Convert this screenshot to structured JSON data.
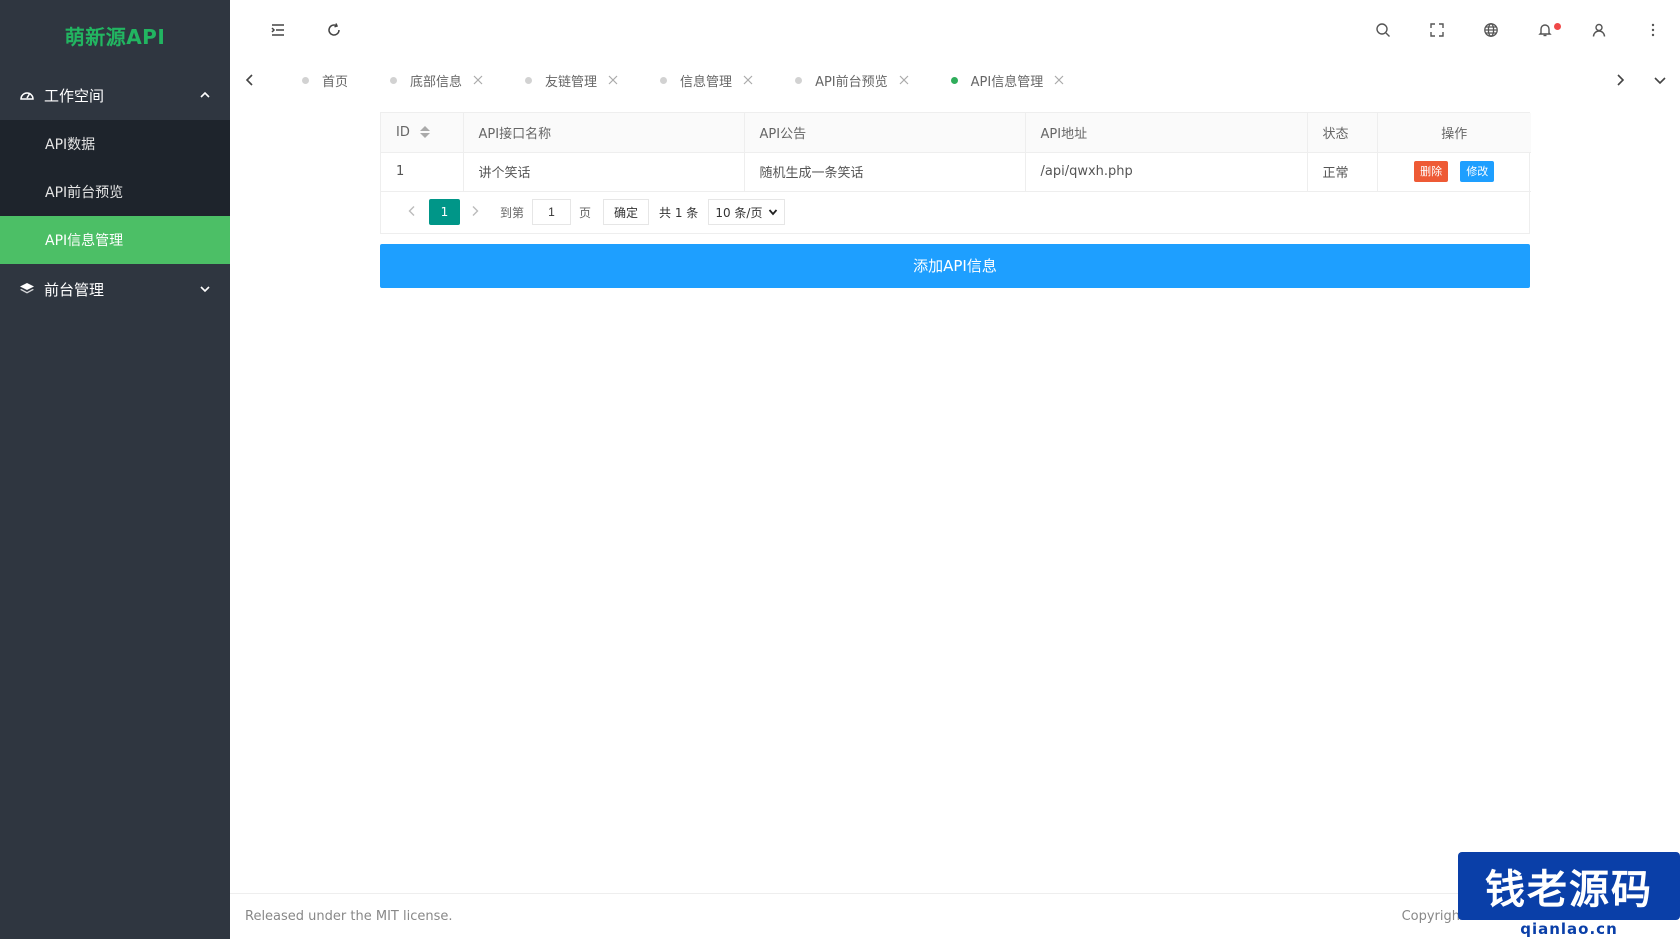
{
  "app": {
    "logo": "萌新源API"
  },
  "sidebar": {
    "groups": [
      {
        "label": "工作空间",
        "icon": "dashboard-icon",
        "expanded": true,
        "items": [
          {
            "label": "API数据"
          },
          {
            "label": "API前台预览"
          },
          {
            "label": "API信息管理",
            "active": true
          }
        ]
      },
      {
        "label": "前台管理",
        "icon": "layers-icon",
        "expanded": false
      }
    ]
  },
  "tabs": [
    {
      "label": "首页",
      "active": false
    },
    {
      "label": "底部信息",
      "active": false
    },
    {
      "label": "友链管理",
      "active": false
    },
    {
      "label": "信息管理",
      "active": false
    },
    {
      "label": "API前台预览",
      "active": false
    },
    {
      "label": "API信息管理",
      "active": true
    }
  ],
  "table": {
    "headers": [
      "ID",
      "API接口名称",
      "API公告",
      "API地址",
      "状态",
      "操作"
    ],
    "rows": [
      {
        "id": "1",
        "name": "讲个笑话",
        "notice": "随机生成一条笑话",
        "url": "/api/qwxh.php",
        "status": "正常"
      }
    ],
    "delete_label": "删除",
    "edit_label": "修改"
  },
  "pager": {
    "current": "1",
    "goto_label": "到第",
    "goto_value": "1",
    "page_label": "页",
    "confirm_label": "确定",
    "total": "共 1 条",
    "page_size": "10 条/页"
  },
  "add_button": "添加API信息",
  "footer": {
    "license": "Released under the MIT license.",
    "copyright": "Copyrigh"
  },
  "watermark": {
    "text": "钱老源码",
    "sub": "qianlao.cn"
  },
  "colors": {
    "sidebar_bg": "#2f3640",
    "active_green": "#4cbf66",
    "primary_blue": "#1e9fff",
    "danger": "#ee5a35",
    "pager_teal": "#009688"
  }
}
